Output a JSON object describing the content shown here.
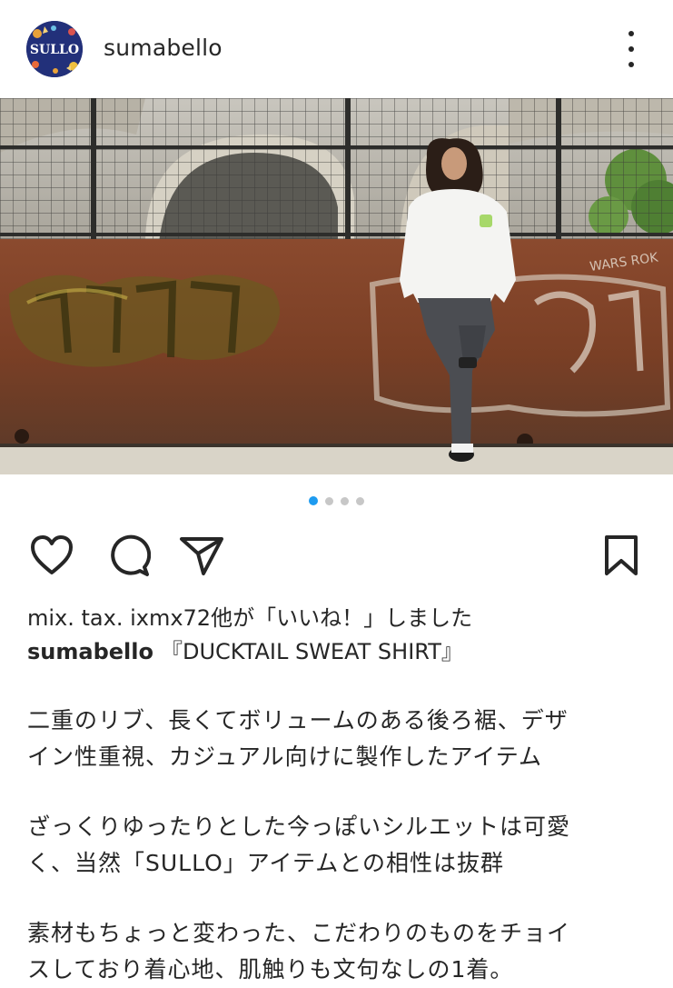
{
  "post": {
    "username": "sumabello",
    "avatar_text": "SULLO",
    "image_graffiti": "WARS ROK",
    "carousel": {
      "total": 4,
      "active_index": 0
    },
    "likes_text": "mix. tax. ixmx72他が「いいね！」しました",
    "caption_user": "sumabello",
    "caption_title": "『DUCKTAIL SWEAT SHIRT』",
    "paragraphs": [
      [
        "二重のリブ、長くてボリュームのある後ろ裾、デザ",
        "イン性重視、カジュアル向けに製作したアイテム"
      ],
      [
        "ざっくりゆったりとした今っぽいシルエットは可愛",
        "く、当然「SULLO」アイテムとの相性は抜群"
      ],
      [
        "素材もちょっと変わった、こだわりのものをチョイ",
        "スしており着心地、肌触りも文句なしの1着。"
      ]
    ]
  },
  "icons": {
    "more": "more-vertical-icon",
    "like": "heart-icon",
    "comment": "comment-icon",
    "share": "send-icon",
    "save": "bookmark-icon"
  },
  "colors": {
    "text": "#262626",
    "active_dot": "#1d9bf0",
    "inactive_dot": "#c7c7c7"
  }
}
